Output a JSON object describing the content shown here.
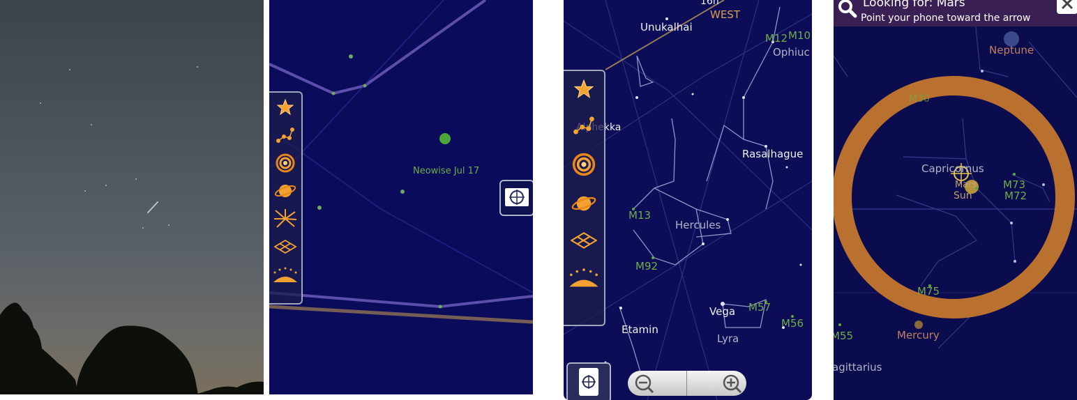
{
  "panel2": {
    "comet_label": "Neowise Jul 17"
  },
  "panel3": {
    "ra_label": "16h",
    "direction_label": "WEST",
    "labels": {
      "unukalhai": "Unukalhai",
      "m12": "M12",
      "m10": "M10",
      "ophiuc": "Ophiuc",
      "alphekka": "Alphekka",
      "rasalhague": "Rasalhague",
      "m13": "M13",
      "hercules": "Hercules",
      "m92": "M92",
      "vega": "Vega",
      "m57": "M57",
      "m56": "M56",
      "etamin": "Etamin",
      "lyra": "Lyra"
    }
  },
  "panel4": {
    "search_title": "Looking for: Mars",
    "search_hint": "Point your phone toward the arrow",
    "labels": {
      "neptune": "Neptune",
      "m30": "M30",
      "capricornus": "Capricornus",
      "mars": "Mars",
      "sun": "Sun",
      "m73": "M73",
      "m72": "M72",
      "m75": "M75",
      "m55": "M55",
      "mercury": "Mercury",
      "sagittarius": "agittarius"
    }
  },
  "colors": {
    "panel_sky": "#0a0b5a",
    "label_green": "#6fae49",
    "tool_orange": "#f0a030",
    "search_ring": "#c8782c",
    "search_bar": "#3a1f54"
  },
  "icons": [
    "star-icon",
    "constellation-icon",
    "galaxy-icon",
    "planet-icon",
    "meteor-icon",
    "grid-icon",
    "horizon-icon",
    "camera-icon",
    "zoom-out-icon",
    "zoom-in-icon",
    "search-icon",
    "close-icon"
  ]
}
